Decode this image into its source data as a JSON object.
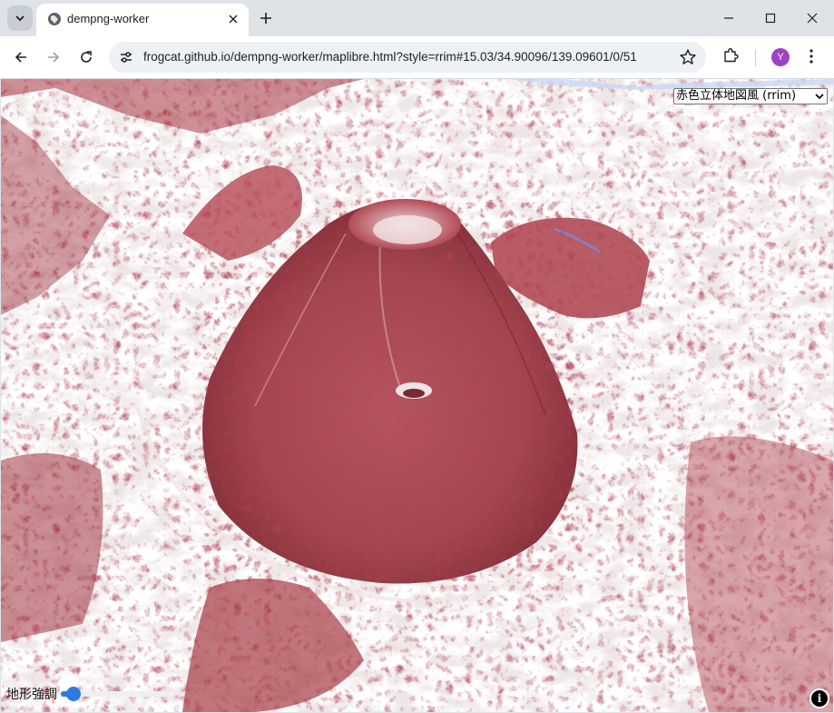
{
  "browser": {
    "tab": {
      "title": "dempng-worker"
    },
    "address_bar": {
      "url": "frogcat.github.io/dempng-worker/maplibre.html?style=rrim#15.03/34.90096/139.09601/0/51"
    },
    "profile_initial": "Y",
    "icons": {
      "tab_search": "chevron-down-icon",
      "favicon": "globe-icon",
      "tab_close": "close-icon",
      "new_tab": "plus-icon",
      "minimize": "minimize-icon",
      "maximize": "maximize-icon",
      "window_close": "close-icon",
      "back": "back-arrow-icon",
      "forward": "forward-arrow-icon",
      "reload": "reload-icon",
      "site_info": "tune-icon",
      "bookmark": "star-icon",
      "extensions": "puzzle-icon",
      "menu": "kebab-menu-icon"
    }
  },
  "map": {
    "style_select": {
      "selected": "赤色立体地図風 (rrim)"
    },
    "exaggeration": {
      "label": "地形強調",
      "value_fraction": 0.05
    },
    "attribution_button": "i",
    "colors": {
      "relief_red": "#c0323c",
      "relief_light": "#e8dcdc"
    }
  }
}
